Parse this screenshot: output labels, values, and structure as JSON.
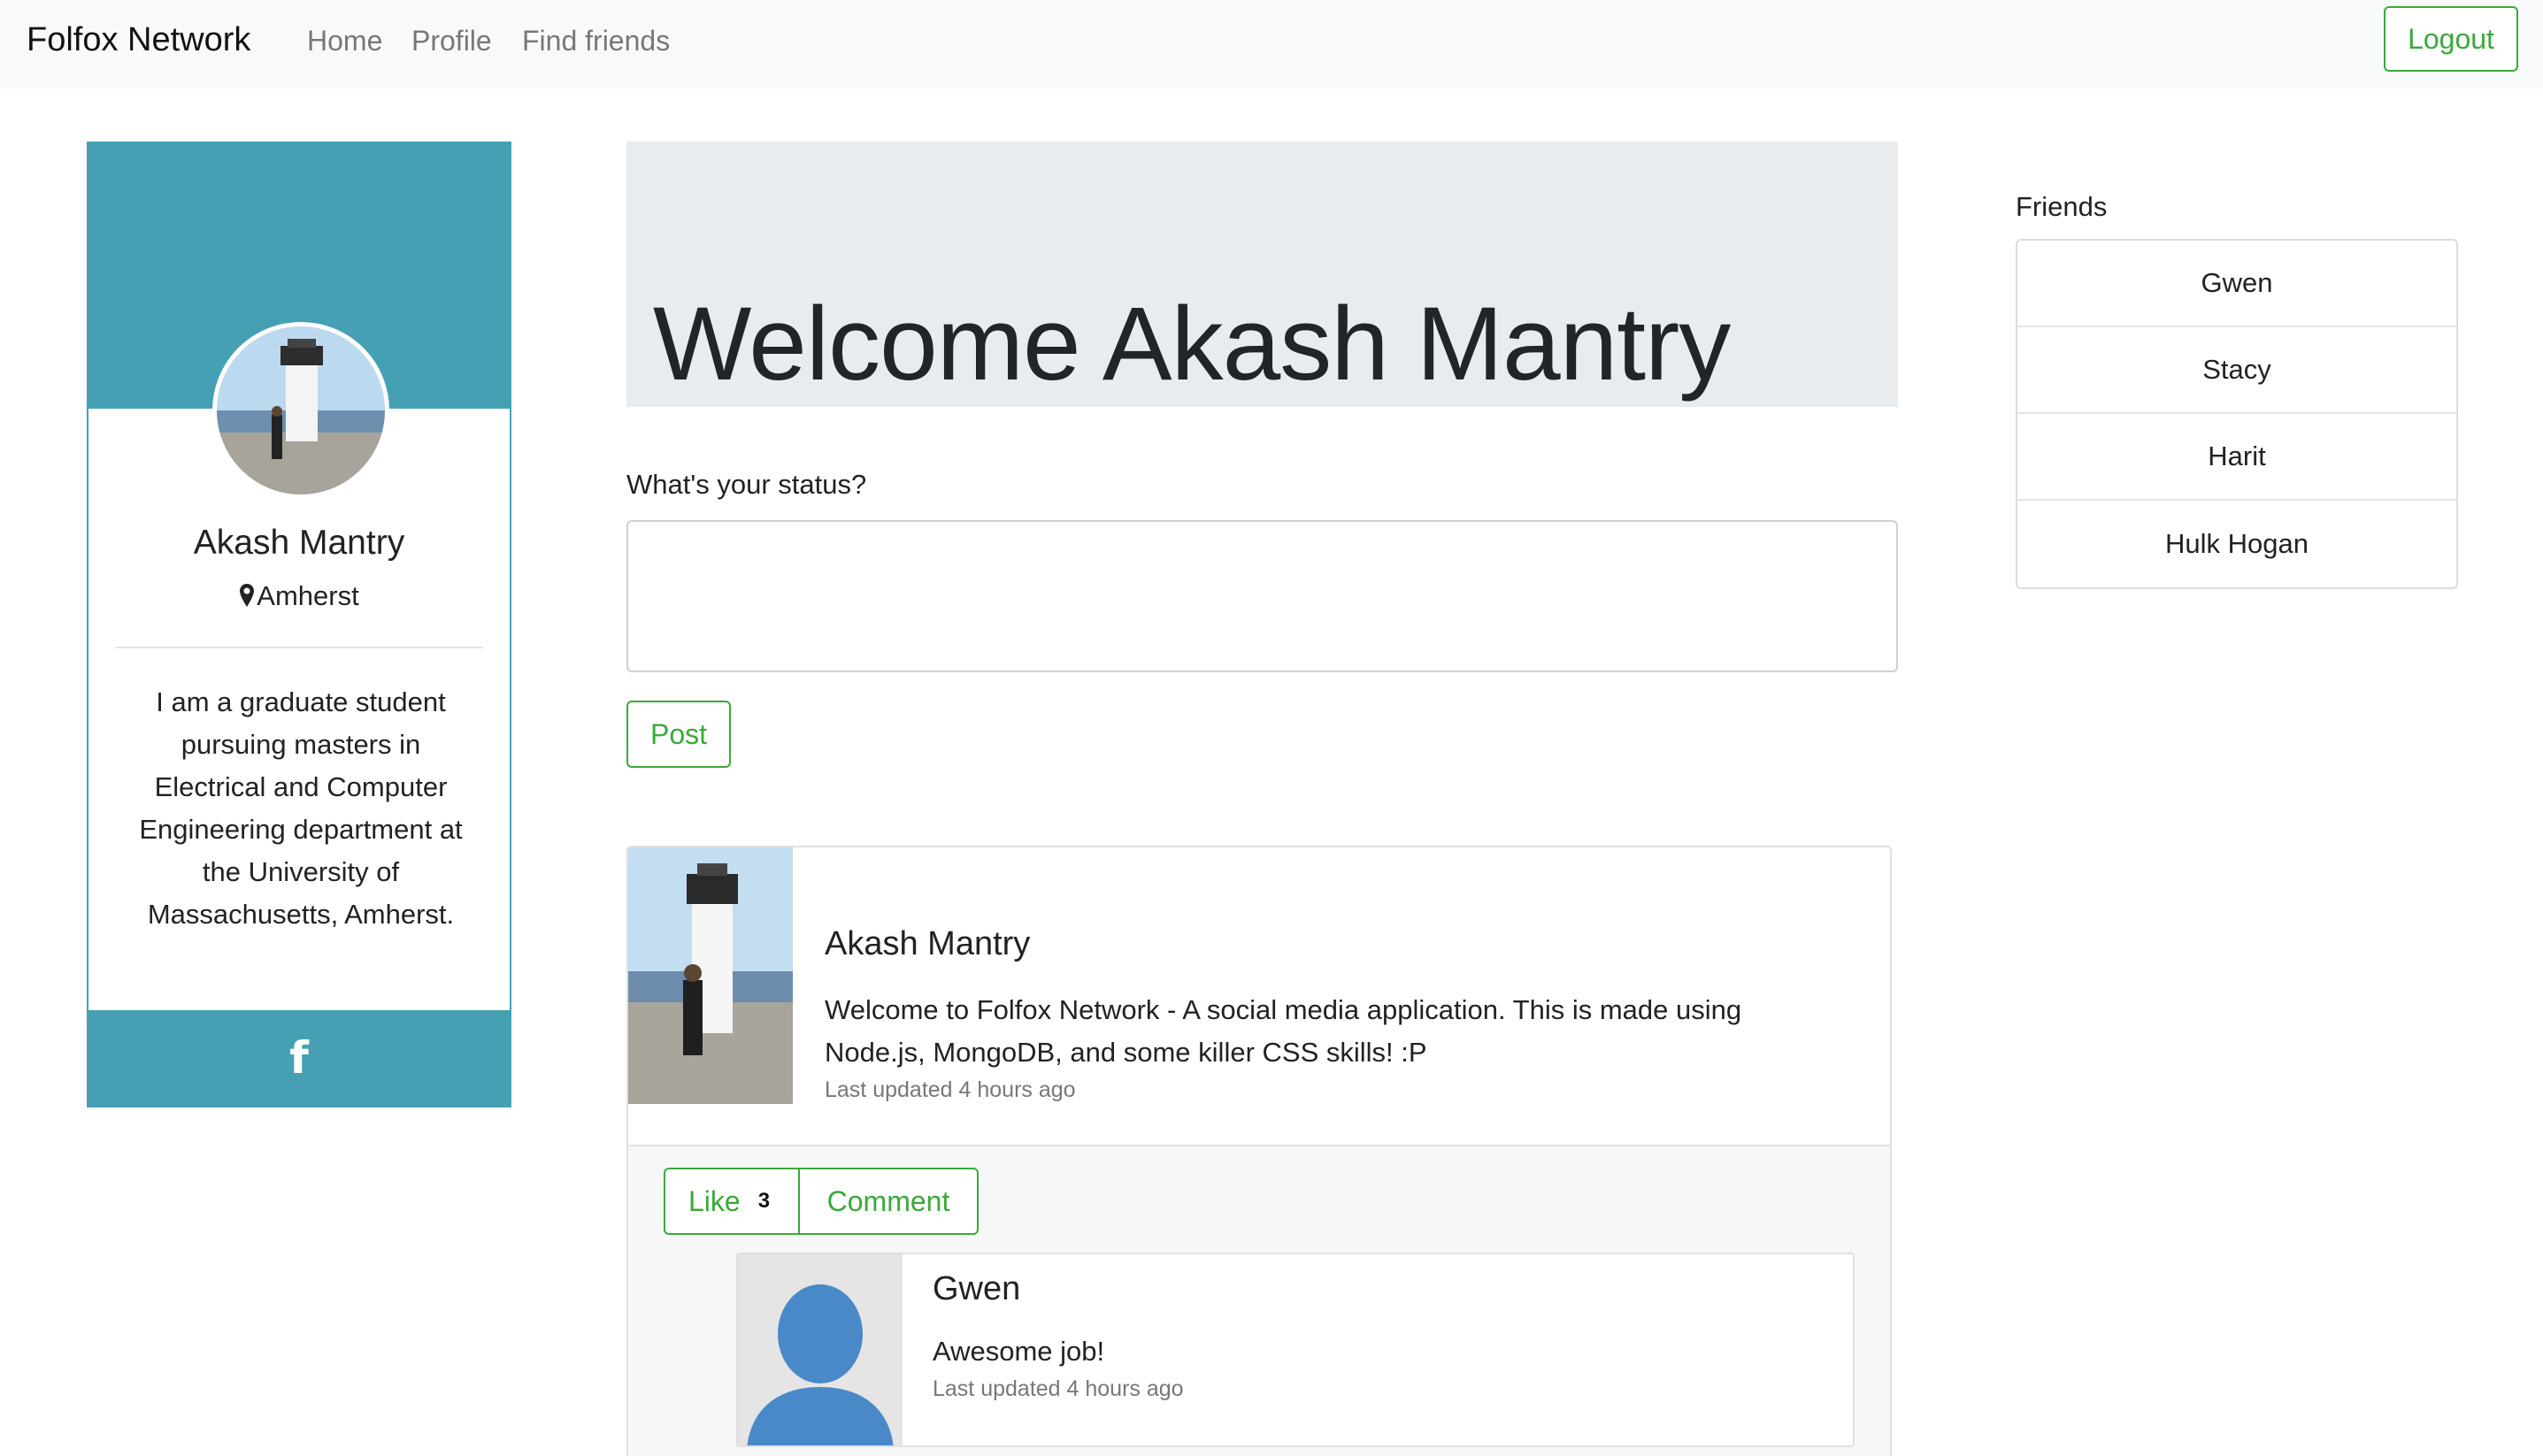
{
  "navbar": {
    "brand": "Folfox Network",
    "links": [
      "Home",
      "Profile",
      "Find friends"
    ],
    "logout_label": "Logout"
  },
  "profile": {
    "name": "Akash Mantry",
    "location": "Amherst",
    "bio": "I am a graduate student pursuing masters in Electrical and Computer Engineering department at the University of Massachusetts, Amherst.",
    "footer_icon": "facebook-icon",
    "accent_color": "#46a0b4"
  },
  "main": {
    "welcome": "Welcome Akash Mantry",
    "status_label": "What's your status?",
    "status_value": "",
    "post_label": "Post"
  },
  "post": {
    "author": "Akash Mantry",
    "body": "Welcome to Folfox Network - A social media application. This is made using Node.js, MongoDB, and some killer CSS skills! :P",
    "time": "Last updated 4 hours ago",
    "like_label": "Like",
    "like_count": "3",
    "comment_label": "Comment",
    "comment": {
      "author": "Gwen",
      "text": "Awesome job!",
      "time": "Last updated 4 hours ago"
    }
  },
  "friends": {
    "title": "Friends",
    "items": [
      "Gwen",
      "Stacy",
      "Harit",
      "Hulk Hogan"
    ]
  },
  "colors": {
    "button_green": "#3aa93a",
    "navbar_bg": "#f8f9fa",
    "jumbotron_bg": "#e9ecef"
  }
}
